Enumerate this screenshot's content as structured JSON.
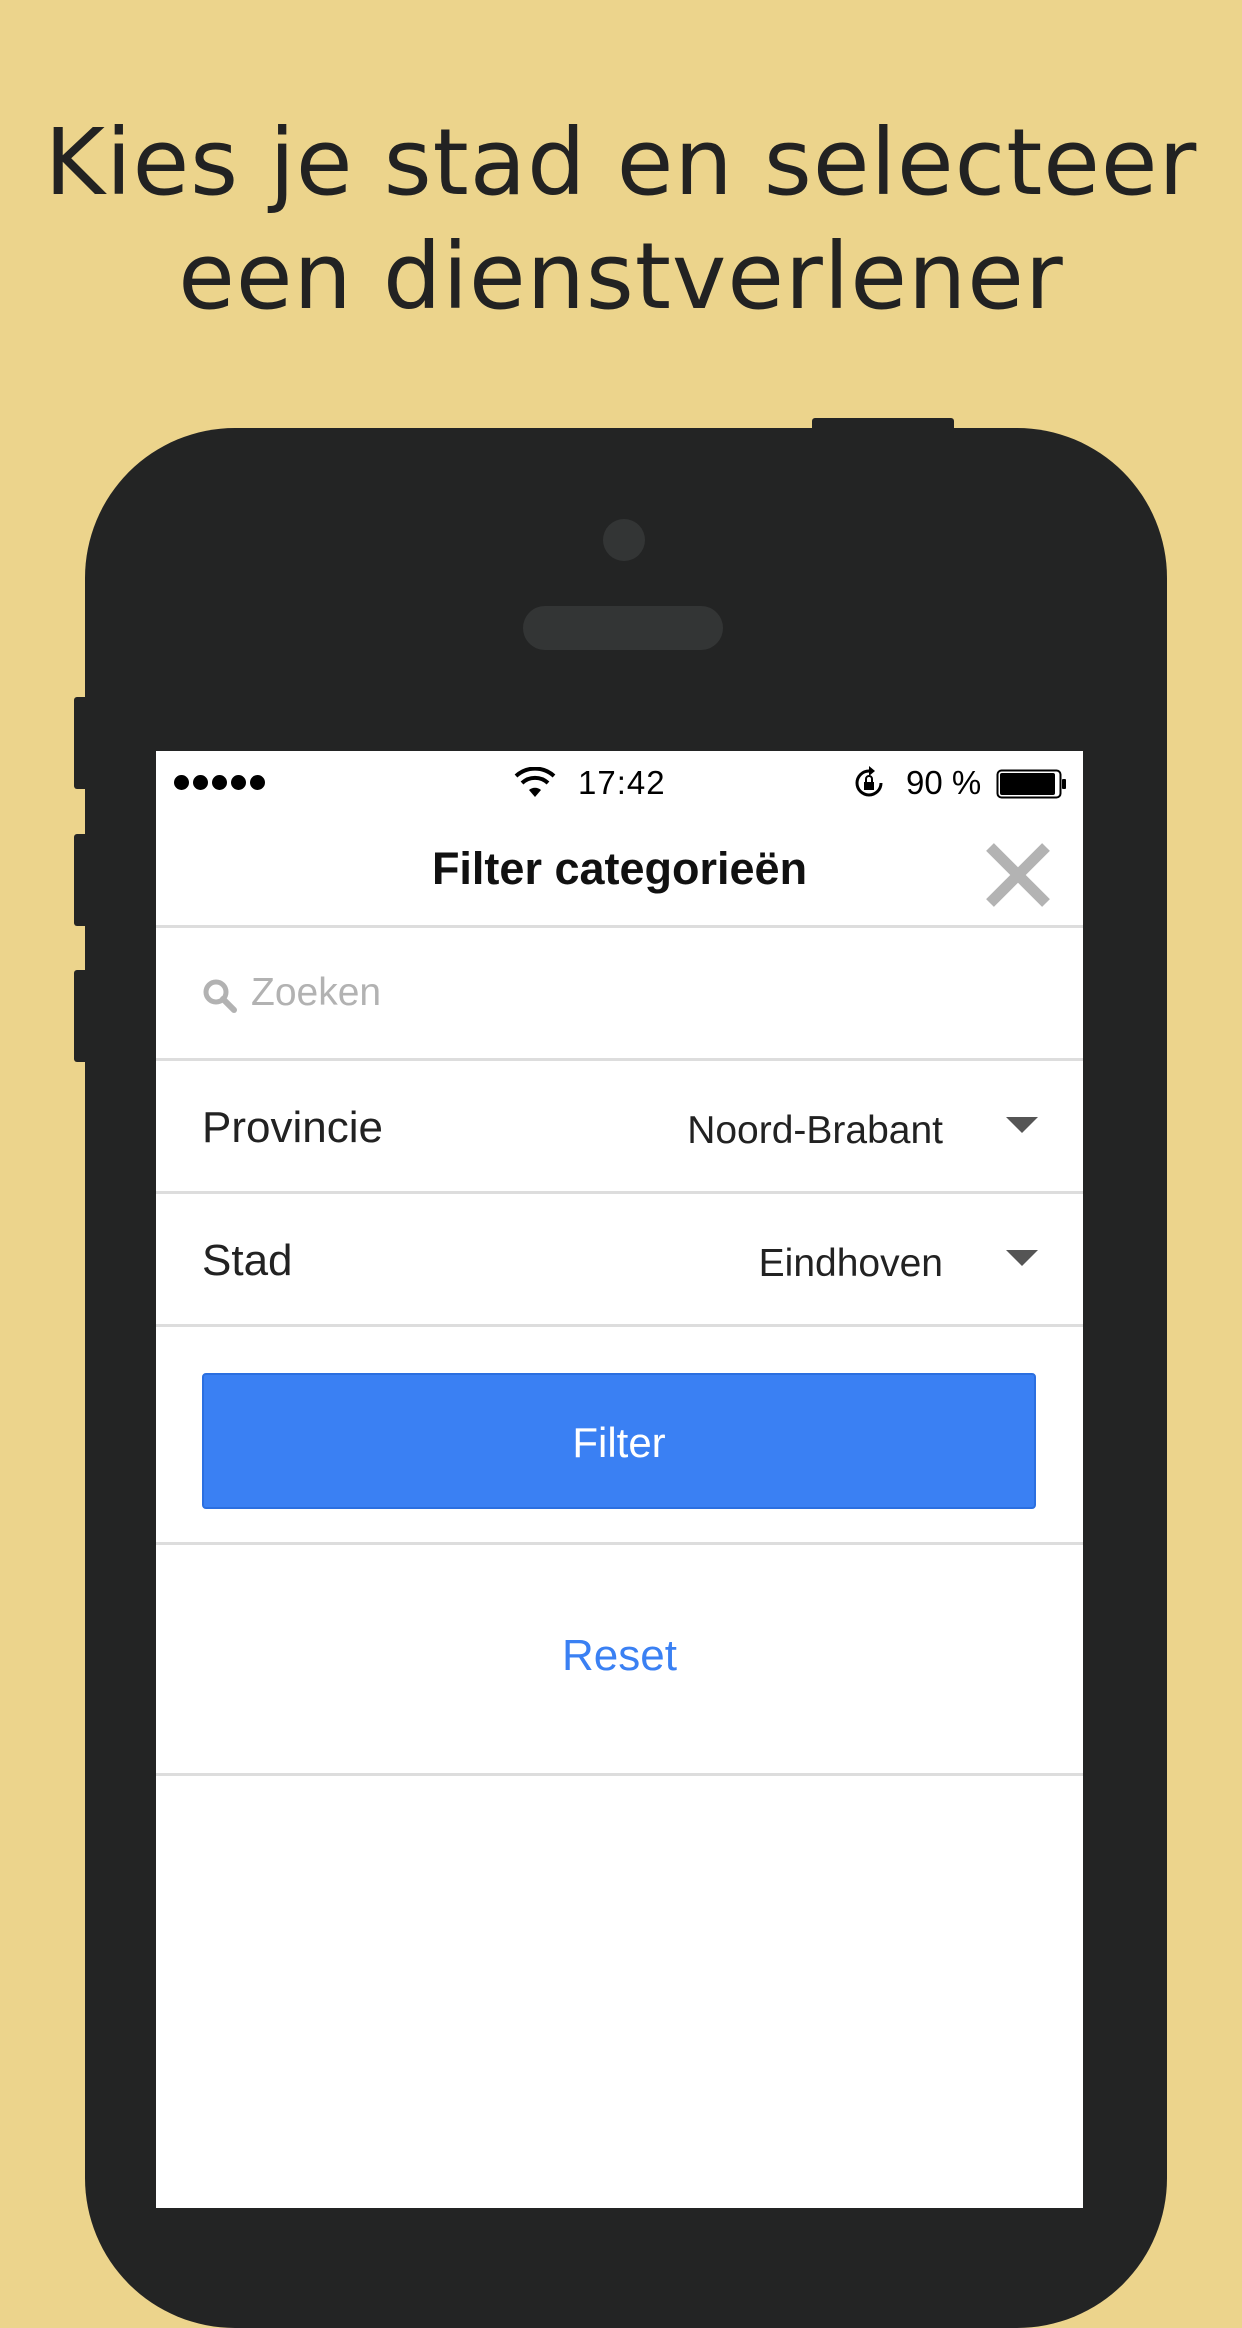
{
  "headline": {
    "line1": "Kies je stad en selecteer",
    "line2": "een dienstverlener"
  },
  "status_bar": {
    "time": "17:42",
    "battery": "90 %"
  },
  "nav": {
    "title": "Filter categorieën",
    "close_icon": "close-icon"
  },
  "search": {
    "placeholder": "Zoeken",
    "value": ""
  },
  "filters": {
    "province": {
      "label": "Provincie",
      "value": "Noord-Brabant"
    },
    "city": {
      "label": "Stad",
      "value": "Eindhoven"
    }
  },
  "actions": {
    "filter_label": "Filter",
    "reset_label": "Reset"
  },
  "colors": {
    "background": "#ECD48C",
    "phone": "#232424",
    "accent": "#3A80F3"
  }
}
